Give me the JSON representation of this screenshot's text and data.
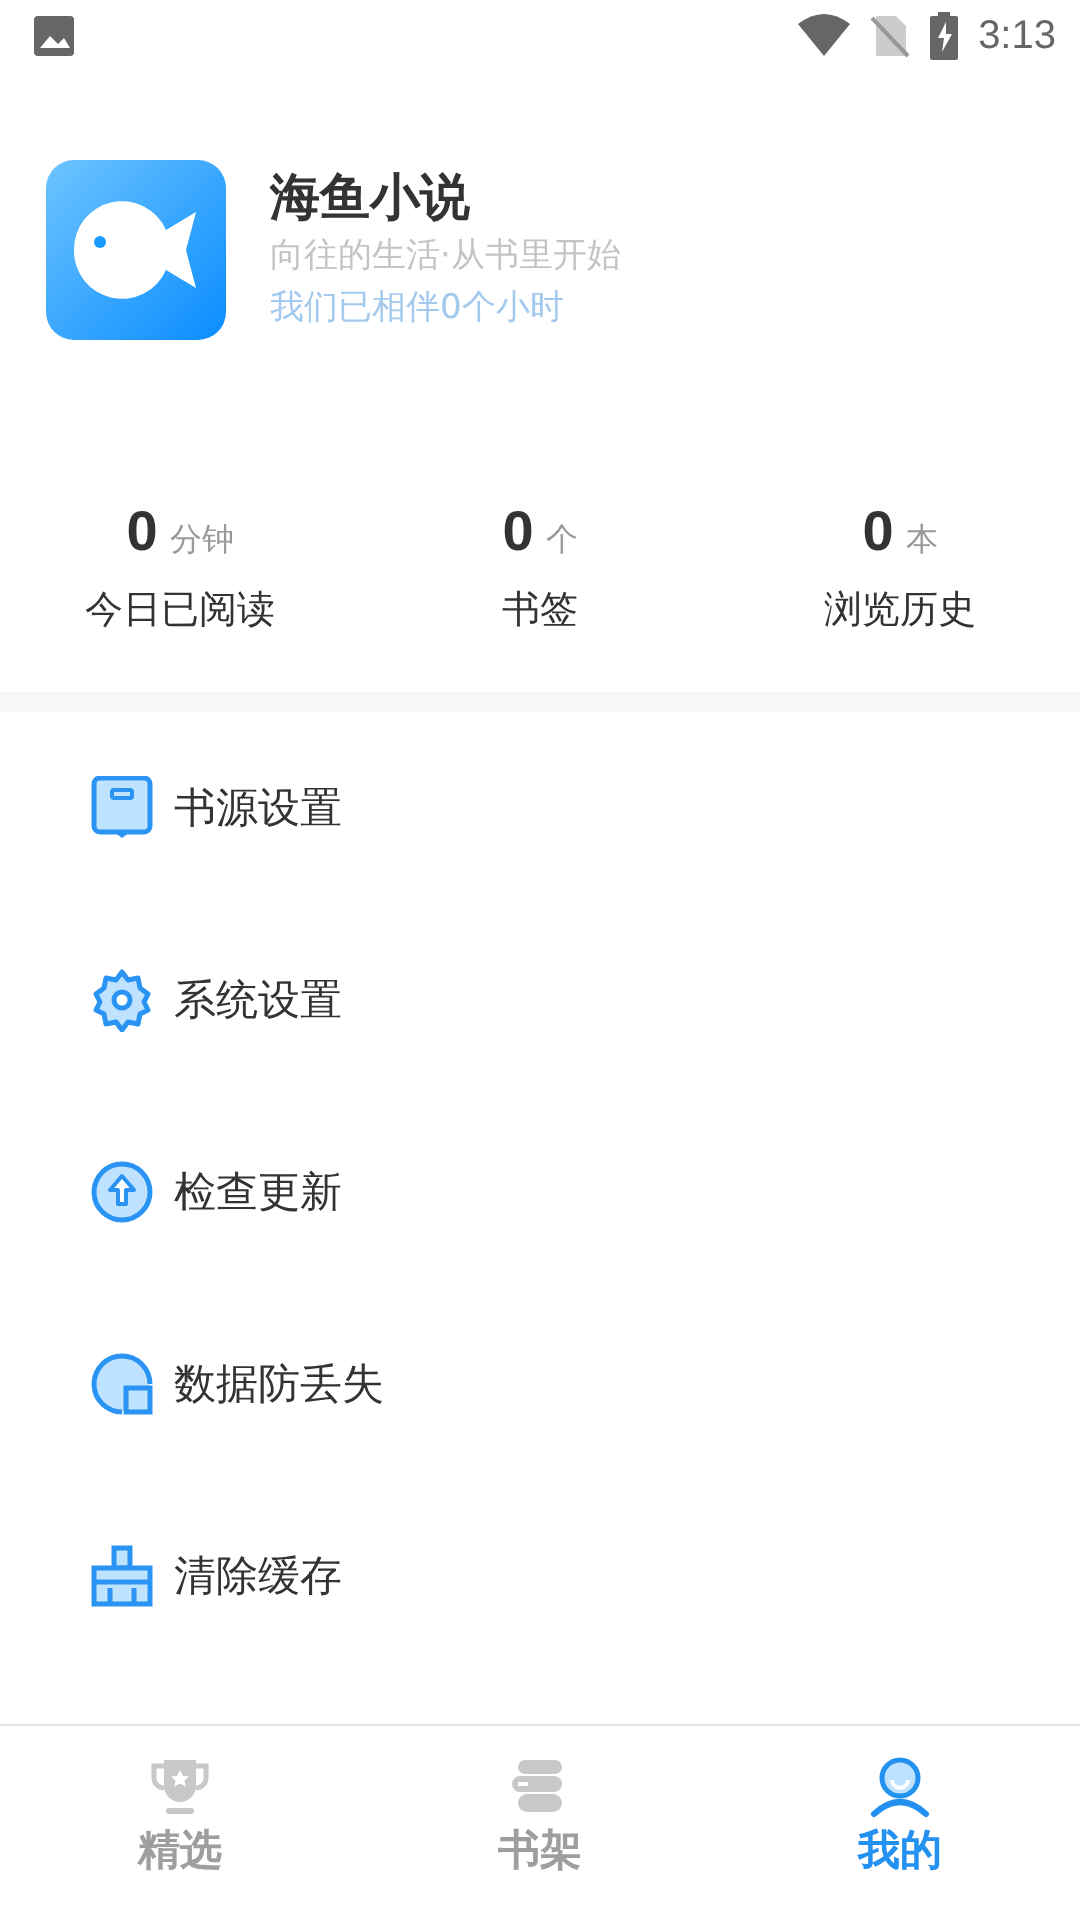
{
  "status_bar": {
    "time": "3:13"
  },
  "profile": {
    "name": "海鱼小说",
    "slogan": "向往的生活·从书里开始",
    "companion": "我们已相伴0个小时"
  },
  "stats": [
    {
      "value": "0",
      "unit": "分钟",
      "label": "今日已阅读"
    },
    {
      "value": "0",
      "unit": "个",
      "label": "书签"
    },
    {
      "value": "0",
      "unit": "本",
      "label": "浏览历史"
    }
  ],
  "menu": [
    {
      "kind": "source",
      "label": "书源设置"
    },
    {
      "kind": "settings",
      "label": "系统设置"
    },
    {
      "kind": "update",
      "label": "检查更新"
    },
    {
      "kind": "backup",
      "label": "数据防丢失"
    },
    {
      "kind": "clean",
      "label": "清除缓存"
    }
  ],
  "tabs": [
    {
      "kind": "featured",
      "label": "精选",
      "selected": false
    },
    {
      "kind": "shelf",
      "label": "书架",
      "selected": false
    },
    {
      "kind": "mine",
      "label": "我的",
      "selected": true
    }
  ]
}
